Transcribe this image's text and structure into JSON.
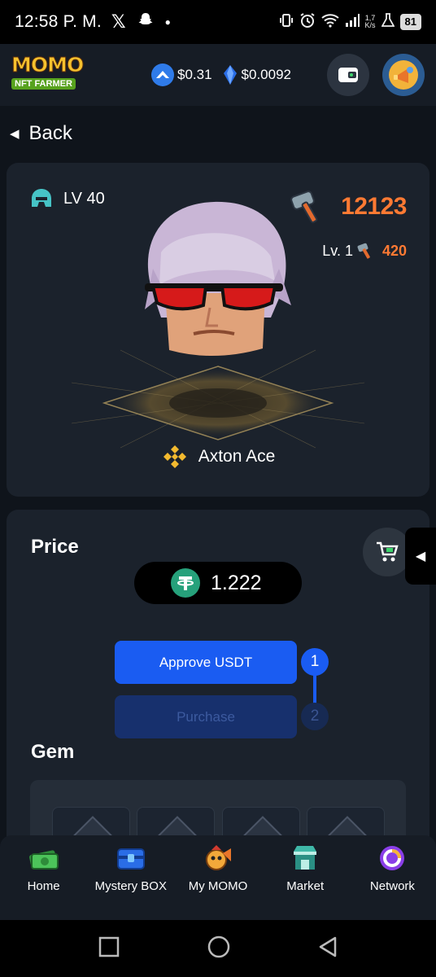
{
  "status_bar": {
    "time": "12:58 P. M.",
    "net_speed_top": "1,7",
    "net_speed_bottom": "K/s",
    "battery": "81"
  },
  "header": {
    "logo_main": "MOMO",
    "logo_sub": "NFT FARMER",
    "token_a_price": "$0.31",
    "token_b_price": "$0.0092"
  },
  "back_label": "Back",
  "hero": {
    "level": "LV 40",
    "power": "12123",
    "tool_level_label": "Lv. 1",
    "tool_power": "420",
    "name": "Axton Ace"
  },
  "price_section": {
    "title": "Price",
    "value": "1.222",
    "approve_label": "Approve USDT",
    "purchase_label": "Purchase",
    "step1": "1",
    "step2": "2",
    "gem_title": "Gem"
  },
  "nav": {
    "items": [
      {
        "label": "Home"
      },
      {
        "label": "Mystery BOX"
      },
      {
        "label": "My MOMO"
      },
      {
        "label": "Market"
      },
      {
        "label": "Network"
      }
    ]
  }
}
